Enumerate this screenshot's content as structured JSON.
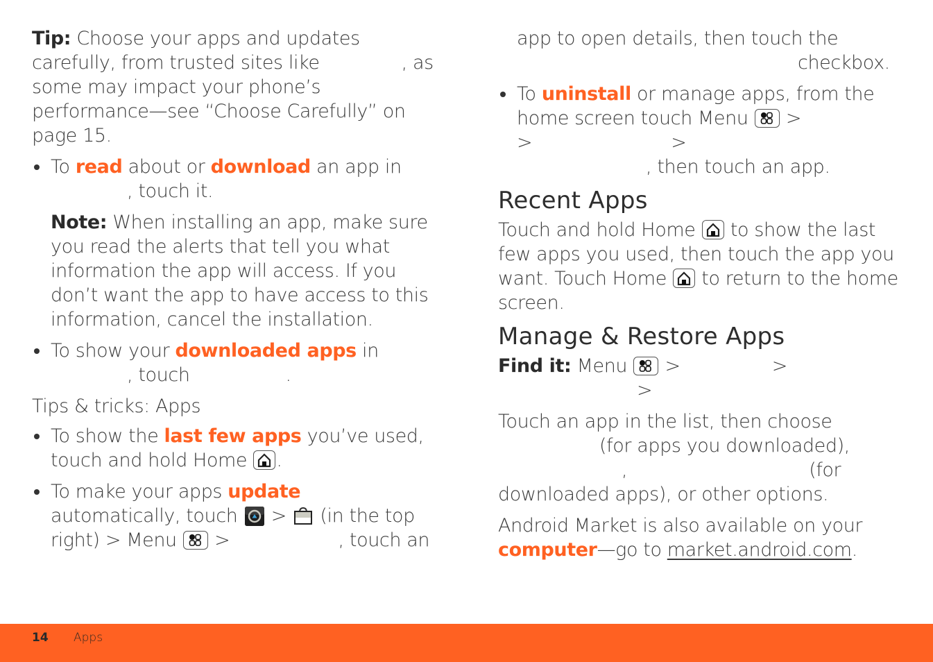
{
  "accent_color": "#ff6122",
  "left_column": {
    "tip": {
      "label": "Tip:",
      "text_before": " Choose your apps and updates carefully, from trusted sites like",
      "text_after": ", as some may impact your phone’s performance—see “Choose Carefully” on page 15."
    },
    "bullet_read": {
      "prefix": "To ",
      "kw1": "read",
      "mid": " about or ",
      "kw2": "download",
      "suffix1": " an app in",
      "suffix2": ", touch it."
    },
    "note": {
      "label": "Note:",
      "text": " When installing an app, make sure you read the alerts that tell you what information the app will access. If you don’t want the app to have access to this information, cancel the installation."
    },
    "bullet_downloaded": {
      "prefix": "To show your ",
      "kw": "downloaded apps",
      "suffix1": " in",
      "suffix2": ", touch",
      "suffix3": "."
    },
    "tips_heading": "Tips & tricks: Apps",
    "bullet_last_few": {
      "prefix": "To show the ",
      "kw": "last few apps",
      "suffix": " you’ve used, touch and hold Home",
      "end": "."
    },
    "bullet_update": {
      "prefix": "To make your apps ",
      "kw": "update",
      "line2_start": "automatically, touch",
      "sep1": " > ",
      "after_bag": " (in the top right) > Menu",
      "sep2": " > ",
      "end": ", touch an"
    }
  },
  "right_column": {
    "update_cont": {
      "line1": "app to open details, then touch the",
      "line2": "checkbox."
    },
    "bullet_uninstall": {
      "prefix": "To ",
      "kw": "uninstall",
      "suffix": " or manage apps, from the home screen touch Menu",
      "sep": " >",
      "line3_a": ">",
      "line3_b": ">",
      "end": ", then touch an app."
    },
    "recent_apps": {
      "heading": "Recent Apps",
      "text1": "Touch and hold Home",
      "text2": " to show the last few apps you used, then touch the app you want. Touch Home",
      "text3": " to return to the home screen."
    },
    "manage_restore": {
      "heading": "Manage & Restore Apps",
      "find_it_label": "Find it:",
      "find_it_text": " Menu",
      "sep1": " >",
      "sep2": ">",
      "sep3": ">",
      "touch_text_1": "Touch an app in the list, then choose",
      "touch_text_2": "(for apps you downloaded),",
      "touch_text_3": ",",
      "touch_text_4": "(for",
      "touch_text_5": "downloaded apps), or other options."
    },
    "market_line": {
      "text1": "Android Market is also available on your ",
      "kw": "computer",
      "text2": "—go to ",
      "link": "market.android.com",
      "end": "."
    }
  },
  "footer": {
    "page_number": "14",
    "section_title": "Apps"
  },
  "icons": {
    "home": "home-icon",
    "menu": "menu-icon",
    "market": "market-app-icon",
    "shopping_bag": "shopping-bag-icon"
  }
}
